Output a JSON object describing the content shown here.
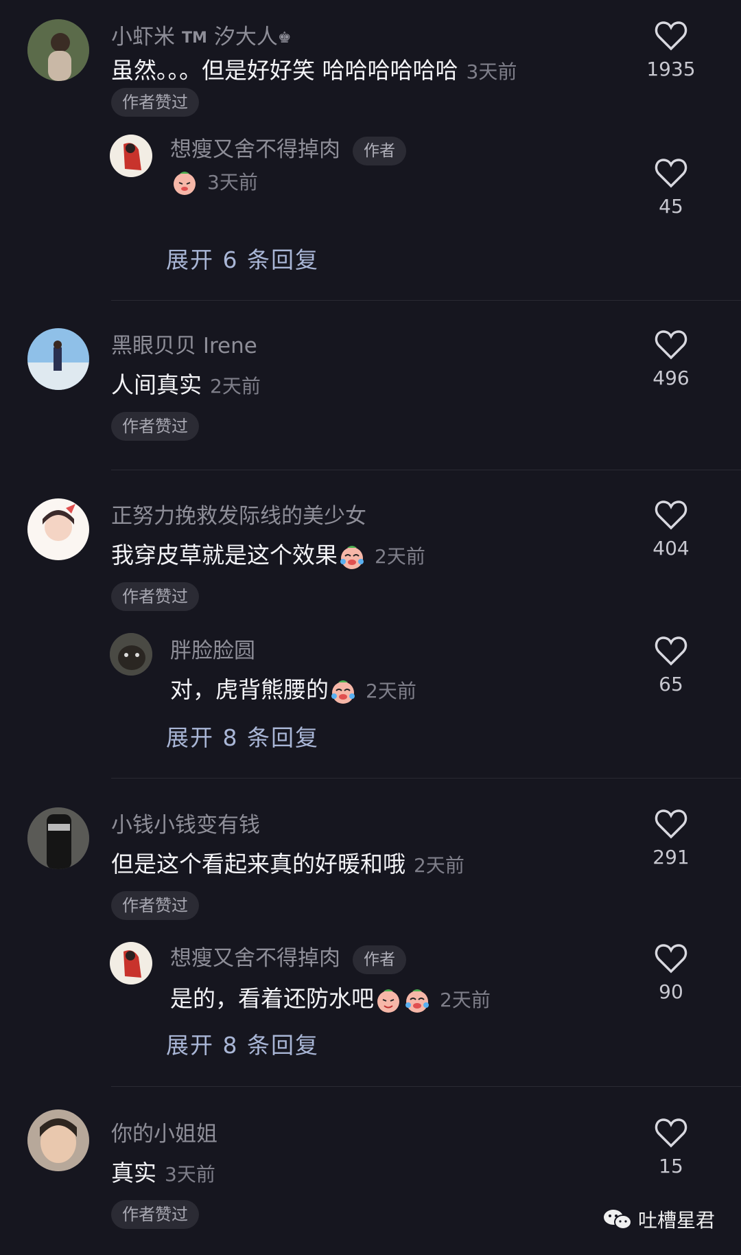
{
  "comments": [
    {
      "name": "小虾米",
      "name_suffix": "汐大人",
      "text": "虽然。。。但是好好笑 哈哈哈哈哈哈",
      "time": "3天前",
      "likes": "1935",
      "badge": "作者赞过",
      "reply": {
        "name": "想瘦又舍不得掉肉",
        "author_tag": "作者",
        "text": "",
        "time": "3天前",
        "likes": "45"
      },
      "expand": "展开 6 条回复"
    },
    {
      "name": "黑眼贝贝 Irene",
      "text": "人间真实",
      "time": "2天前",
      "likes": "496",
      "badge": "作者赞过"
    },
    {
      "name": "正努力挽救发际线的美少女",
      "text": "我穿皮草就是这个效果",
      "time": "2天前",
      "likes": "404",
      "badge": "作者赞过",
      "reply": {
        "name": "胖脸脸圆",
        "text": "对，虎背熊腰的",
        "time": "2天前",
        "likes": "65"
      },
      "expand": "展开 8 条回复"
    },
    {
      "name": "小钱小钱变有钱",
      "text": "但是这个看起来真的好暖和哦",
      "time": "2天前",
      "likes": "291",
      "badge": "作者赞过",
      "reply": {
        "name": "想瘦又舍不得掉肉",
        "author_tag": "作者",
        "text": "是的，看着还防水吧",
        "time": "2天前",
        "likes": "90"
      },
      "expand": "展开 8 条回复"
    },
    {
      "name": "你的小姐姐",
      "text": "真实",
      "time": "3天前",
      "likes": "15",
      "badge": "作者赞过"
    }
  ],
  "tm_mark": "TM",
  "watermark": "吐槽星君",
  "icons": {
    "like": "heart-icon",
    "crown": "crown-icon",
    "watermark": "wechat-icon"
  },
  "colors": {
    "background": "#16161f",
    "expand_link": "#a9b6d6"
  }
}
